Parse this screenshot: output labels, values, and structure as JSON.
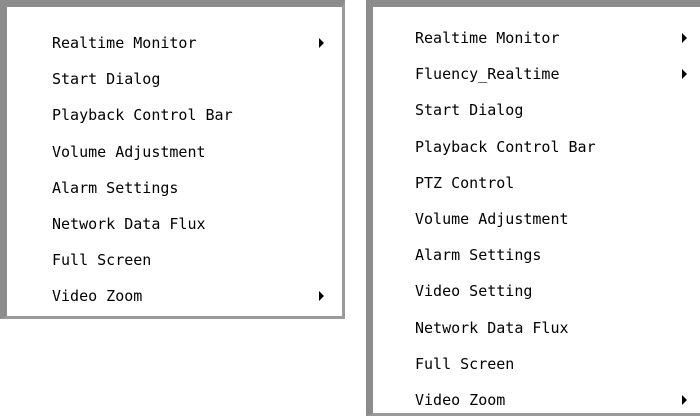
{
  "menu_left": {
    "items": [
      {
        "label": "Realtime Monitor",
        "submenu": true
      },
      {
        "label": "Start Dialog",
        "submenu": false
      },
      {
        "label": "Playback Control Bar",
        "submenu": false
      },
      {
        "label": "Volume Adjustment",
        "submenu": false
      },
      {
        "label": "Alarm Settings",
        "submenu": false
      },
      {
        "label": "Network Data Flux",
        "submenu": false
      },
      {
        "label": "Full Screen",
        "submenu": false
      },
      {
        "label": "Video Zoom",
        "submenu": true
      }
    ]
  },
  "menu_right": {
    "items": [
      {
        "label": "Realtime Monitor",
        "submenu": true
      },
      {
        "label": "Fluency_Realtime",
        "submenu": true
      },
      {
        "label": "Start Dialog",
        "submenu": false
      },
      {
        "label": "Playback Control Bar",
        "submenu": false
      },
      {
        "label": "PTZ Control",
        "submenu": false
      },
      {
        "label": "Volume Adjustment",
        "submenu": false
      },
      {
        "label": "Alarm Settings",
        "submenu": false
      },
      {
        "label": "Video Setting",
        "submenu": false
      },
      {
        "label": "Network Data Flux",
        "submenu": false
      },
      {
        "label": "Full Screen",
        "submenu": false
      },
      {
        "label": "Video Zoom",
        "submenu": true
      }
    ]
  },
  "icons": {
    "submenu_arrow": "triangle-right-icon"
  }
}
